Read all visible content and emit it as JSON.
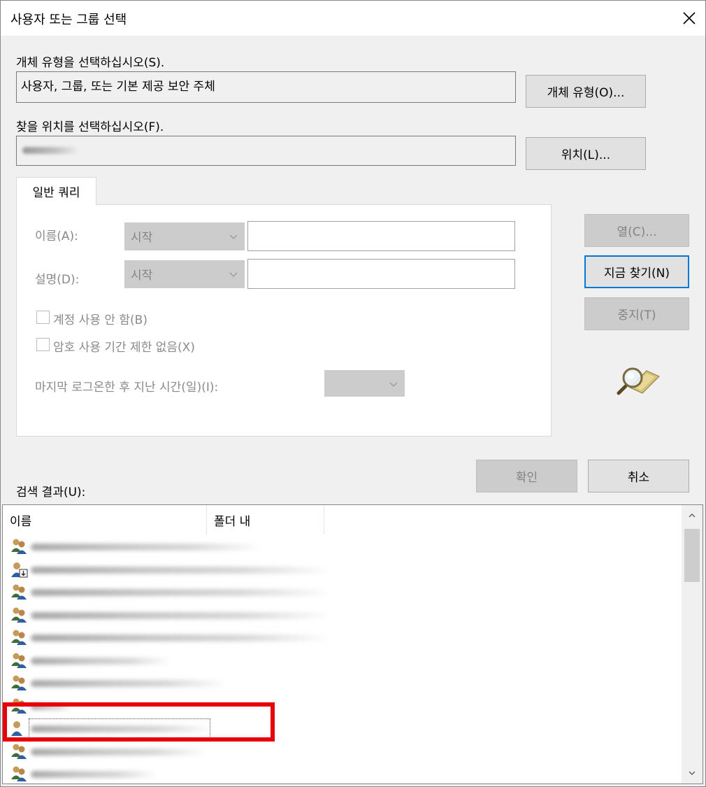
{
  "dialog": {
    "title": "사용자 또는 그룹 선택"
  },
  "object_type": {
    "label": "개체 유형을 선택하십시오(S).",
    "value": "사용자, 그룹, 또는 기본 제공 보안 주체",
    "button": "개체 유형(O)..."
  },
  "location": {
    "label": "찾을 위치를 선택하십시오(F).",
    "button": "위치(L)..."
  },
  "query": {
    "tab_label": "일반 쿼리",
    "name_label": "이름(A):",
    "name_mode": "시작",
    "desc_label": "설명(D):",
    "desc_mode": "시작",
    "disabled_accounts": "계정 사용 안 함(B)",
    "non_expiring_pw": "암호 사용 기간 제한 없음(X)",
    "last_logon": "마지막 로그온한 후 지난 시간(일)(I):"
  },
  "side_buttons": {
    "columns": "열(C)...",
    "find_now": "지금 찾기(N)",
    "stop": "중지(T)"
  },
  "actions": {
    "ok": "확인",
    "cancel": "취소"
  },
  "results": {
    "label": "검색 결과(U):",
    "columns": [
      "이름",
      "폴더 내"
    ],
    "rows": [
      {
        "icon": "group-icon"
      },
      {
        "icon": "user-download-icon"
      },
      {
        "icon": "group-icon"
      },
      {
        "icon": "group-icon"
      },
      {
        "icon": "group-icon"
      },
      {
        "icon": "group-icon"
      },
      {
        "icon": "group-icon"
      },
      {
        "icon": "group-icon"
      },
      {
        "icon": "user-icon",
        "selected": true
      },
      {
        "icon": "group-icon"
      },
      {
        "icon": "group-icon"
      }
    ]
  },
  "colors": {
    "accent": "#0078d7",
    "highlight": "#e8000b"
  }
}
